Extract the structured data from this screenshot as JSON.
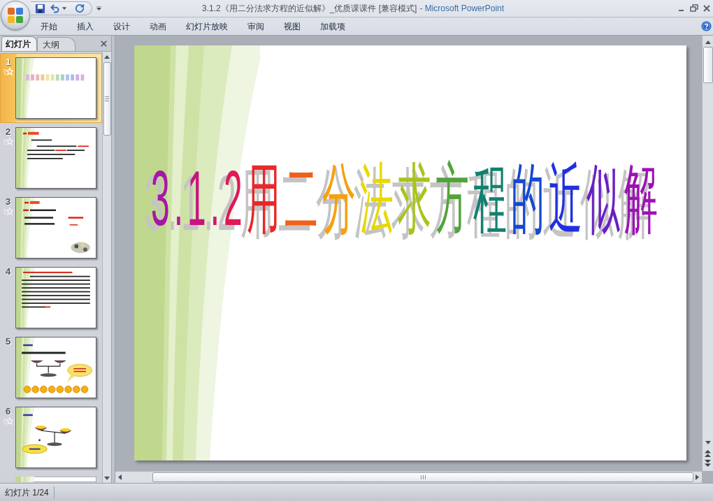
{
  "window": {
    "title": "3.1.2《用二分法求方程的近似解》_优质课课件 [兼容模式]",
    "app_name": "- Microsoft PowerPoint"
  },
  "ribbon_tabs": [
    {
      "label": "开始",
      "selected": false
    },
    {
      "label": "插入",
      "selected": false
    },
    {
      "label": "设计",
      "selected": false
    },
    {
      "label": "动画",
      "selected": false
    },
    {
      "label": "幻灯片放映",
      "selected": false
    },
    {
      "label": "审阅",
      "selected": false
    },
    {
      "label": "视图",
      "selected": false
    },
    {
      "label": "加载项",
      "selected": false
    }
  ],
  "pane_tabs": [
    {
      "label": "幻灯片",
      "selected": true
    },
    {
      "label": "大纲",
      "selected": false
    }
  ],
  "slides": [
    {
      "number": "1",
      "selected": true,
      "animated": true,
      "kind": "title"
    },
    {
      "number": "2",
      "selected": false,
      "animated": true,
      "kind": "text"
    },
    {
      "number": "3",
      "selected": false,
      "animated": true,
      "kind": "formula"
    },
    {
      "number": "4",
      "selected": false,
      "animated": false,
      "kind": "dense"
    },
    {
      "number": "5",
      "selected": false,
      "animated": false,
      "kind": "coins"
    },
    {
      "number": "6",
      "selected": false,
      "animated": true,
      "kind": "cloud"
    }
  ],
  "current_slide": {
    "title": "3.1.2用二分法求方程的近似解"
  },
  "status_bar": {
    "slide_position": "幻灯片 1/24"
  }
}
